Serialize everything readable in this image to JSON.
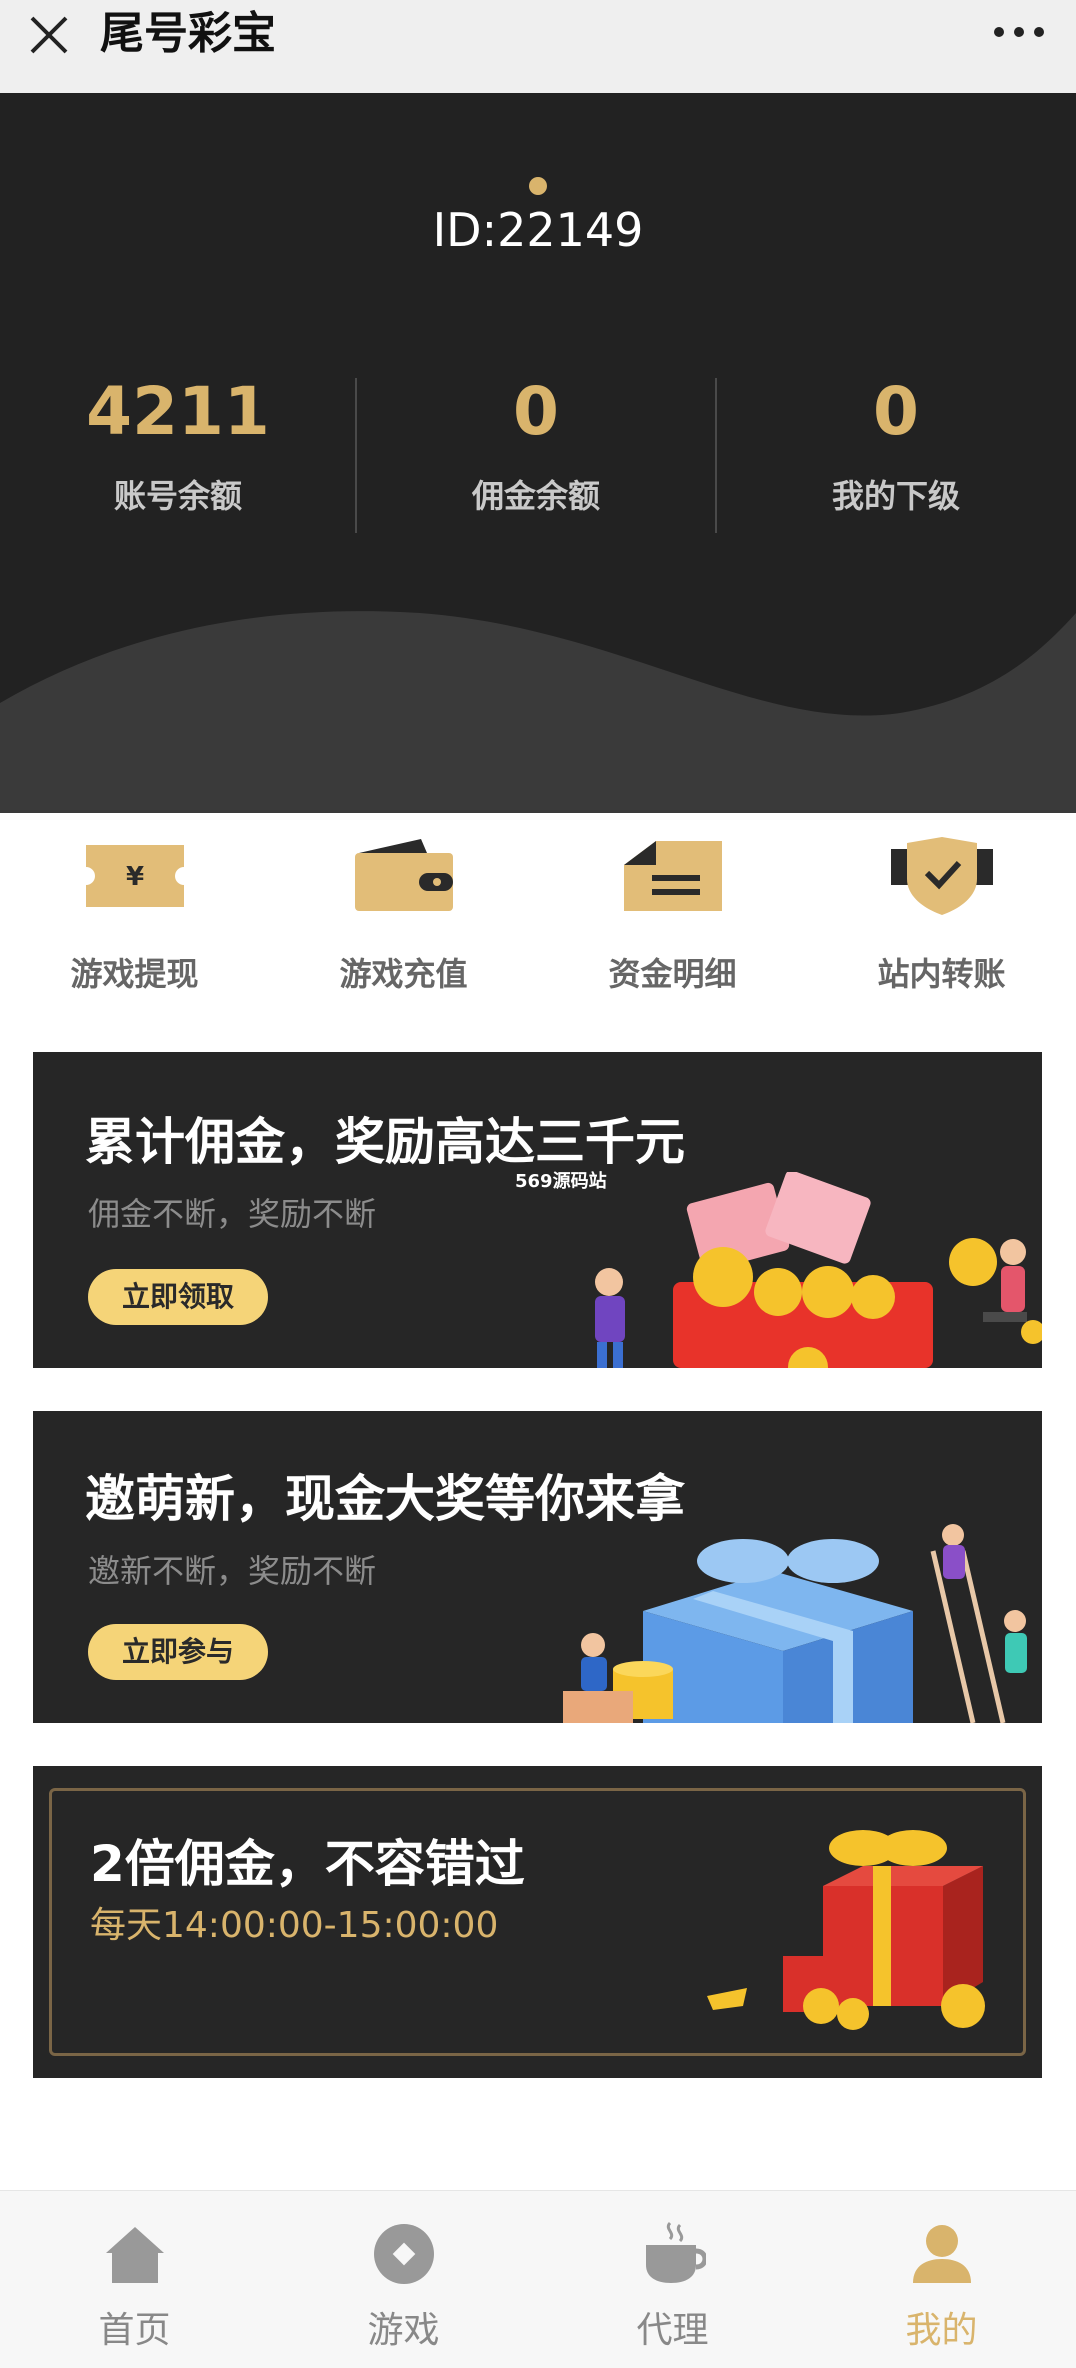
{
  "topbar": {
    "title": "尾号彩宝"
  },
  "header": {
    "user_id": "ID:22149",
    "stats": [
      {
        "value": "4211",
        "label": "账号余额"
      },
      {
        "value": "0",
        "label": "佣金余额"
      },
      {
        "value": "0",
        "label": "我的下级"
      }
    ]
  },
  "actions": [
    {
      "label": "游戏提现",
      "icon": "ticket-yen-icon"
    },
    {
      "label": "游戏充值",
      "icon": "wallet-icon"
    },
    {
      "label": "资金明细",
      "icon": "envelope-list-icon"
    },
    {
      "label": "站内转账",
      "icon": "shield-check-icon"
    }
  ],
  "banners": [
    {
      "title": "累计佣金，奖励高达三千元",
      "subtitle": "佣金不断，奖励不断",
      "button": "立即领取"
    },
    {
      "title": "邀萌新，现金大奖等你来拿",
      "subtitle": "邀新不断，奖励不断",
      "button": "立即参与"
    },
    {
      "title": "2倍佣金，不容错过",
      "time": "每天14:00:00-15:00:00"
    }
  ],
  "watermark": "569源码站",
  "nav": [
    {
      "label": "首页",
      "icon": "home-icon"
    },
    {
      "label": "游戏",
      "icon": "game-icon"
    },
    {
      "label": "代理",
      "icon": "coffee-cup-icon"
    },
    {
      "label": "我的",
      "icon": "user-icon",
      "active": true
    }
  ],
  "colors": {
    "accent": "#d9b46c",
    "dark": "#222222",
    "button": "#f5d478"
  }
}
